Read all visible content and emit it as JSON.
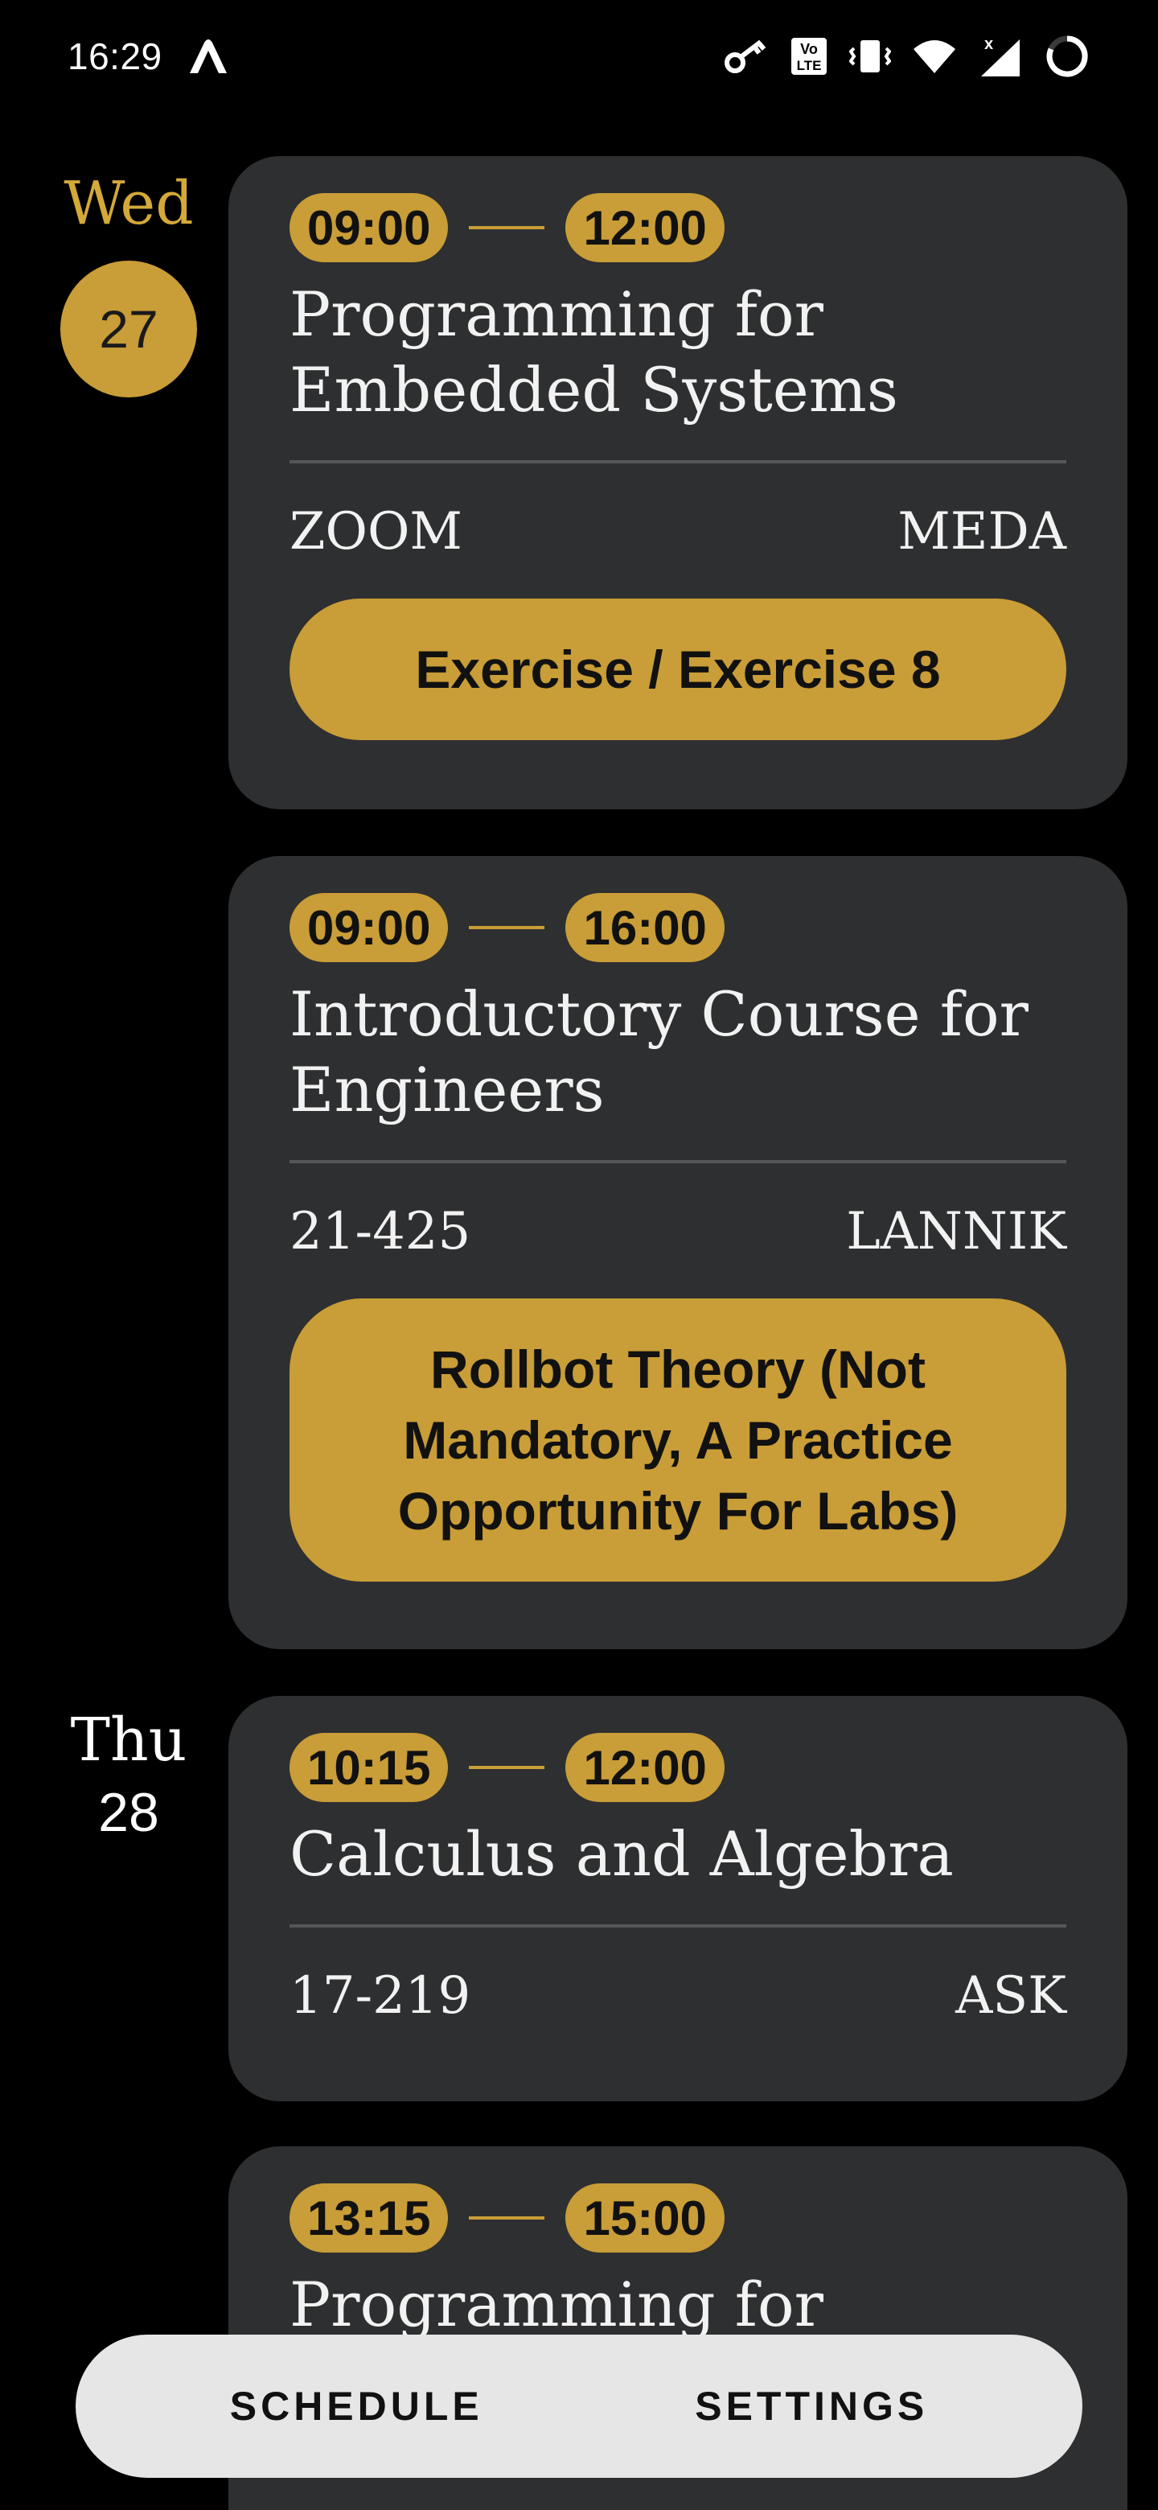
{
  "status_bar": {
    "time": "16:29",
    "icons": [
      "app-notification-icon",
      "vpn-key-icon",
      "volte-icon",
      "vibrate-icon",
      "wifi-icon",
      "signal-icon",
      "battery-icon"
    ],
    "volte_text": "Vo LTE"
  },
  "colors": {
    "accent": "#c99d37",
    "card_background": "#2e2f30",
    "background": "#000000",
    "nav_background": "#e6e6e6"
  },
  "days": [
    {
      "name": "Wed",
      "number": "27",
      "active": true
    },
    {
      "name": "Thu",
      "number": "28",
      "active": false
    }
  ],
  "events": [
    {
      "start": "09:00",
      "end": "12:00",
      "title": "Programming for Embedded Systems",
      "location": "ZOOM",
      "teacher": "MEDA",
      "type": "Exercise / Exercise 8"
    },
    {
      "start": "09:00",
      "end": "16:00",
      "title": "Introductory Course for Engineers",
      "location": "21-425",
      "teacher": "LANNIK",
      "type": "Rollbot Theory (Not Mandatory, A Practice Opportunity For Labs)"
    },
    {
      "start": "10:15",
      "end": "12:00",
      "title": "Calculus and Algebra",
      "location": "17-219",
      "teacher": "ASK"
    },
    {
      "start": "13:15",
      "end": "15:00",
      "title": "Programming for"
    }
  ],
  "bottom_nav": {
    "schedule_label": "SCHEDULE",
    "settings_label": "SETTINGS"
  }
}
